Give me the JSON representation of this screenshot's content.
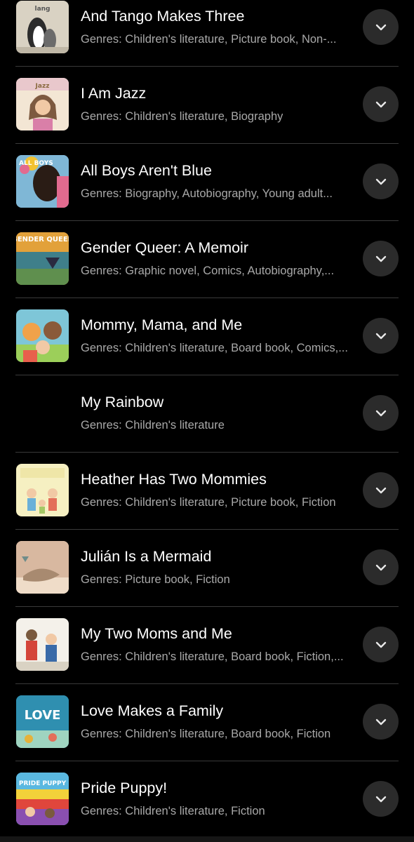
{
  "colors": {
    "background": "#000000",
    "title_text": "#ffffff",
    "genre_text": "#a9a9a9",
    "divider": "#3a3a3a",
    "expand_button_bg": "#2b2b2b",
    "chevron": "#e8e8e8"
  },
  "books": [
    {
      "title": "And Tango Makes Three",
      "genres": "Genres: Children's literature, Picture book, Non-...",
      "thumb_label": "lang",
      "thumb_colors": [
        "#d9d2c3",
        "#2c2c2c",
        "#ffffff",
        "#6b6b6b"
      ],
      "expand_icon": "chevron-down-icon"
    },
    {
      "title": "I Am Jazz",
      "genres": "Genres: Children's literature, Biography",
      "thumb_label": "Jazz",
      "thumb_colors": [
        "#f3e6d4",
        "#c4a38a",
        "#d97fa8",
        "#7d5a40"
      ],
      "expand_icon": "chevron-down-icon"
    },
    {
      "title": "All Boys Aren't Blue",
      "genres": "Genres: Biography, Autobiography, Young adult...",
      "thumb_label": "ALL BOYS",
      "thumb_colors": [
        "#7fb7d6",
        "#2a1c15",
        "#e26a8f",
        "#f2c230"
      ],
      "expand_icon": "chevron-down-icon"
    },
    {
      "title": "Gender Queer: A Memoir",
      "genres": "Genres: Graphic novel, Comics, Autobiography,...",
      "thumb_label": "GENDER QUEER",
      "thumb_colors": [
        "#e2a13a",
        "#3f7f8a",
        "#5f8f4e",
        "#2a2a40"
      ],
      "expand_icon": "chevron-down-icon"
    },
    {
      "title": "Mommy, Mama, and Me",
      "genres": "Genres: Children's literature, Board book, Comics,...",
      "thumb_label": "",
      "thumb_colors": [
        "#7ec6d8",
        "#f0a24a",
        "#e85f4c",
        "#9ccf5a"
      ],
      "expand_icon": "chevron-down-icon"
    },
    {
      "title": "My Rainbow",
      "genres": "Genres: Children's literature",
      "thumb_label": "",
      "thumb_colors": [],
      "expand_icon": "chevron-down-icon"
    },
    {
      "title": "Heather Has Two Mommies",
      "genres": "Genres: Children's literature, Picture book, Fiction",
      "thumb_label": "",
      "thumb_colors": [
        "#f6f0c2",
        "#6ab0d8",
        "#e36f5a",
        "#a5c865"
      ],
      "expand_icon": "chevron-down-icon"
    },
    {
      "title": "Julián Is a Mermaid",
      "genres": "Genres: Picture book, Fiction",
      "thumb_label": "",
      "thumb_colors": [
        "#d8b8a0",
        "#a88a70",
        "#6e8c8a",
        "#efdcc8"
      ],
      "expand_icon": "chevron-down-icon"
    },
    {
      "title": "My Two Moms and Me",
      "genres": "Genres: Children's literature, Board book, Fiction,...",
      "thumb_label": "",
      "thumb_colors": [
        "#f4f1ea",
        "#d4453a",
        "#3a6aa8",
        "#7a5a3e"
      ],
      "expand_icon": "chevron-down-icon"
    },
    {
      "title": "Love Makes a Family",
      "genres": "Genres: Children's literature, Board book, Fiction",
      "thumb_label": "LOVE",
      "thumb_colors": [
        "#2f8fb0",
        "#9fd4c0",
        "#ffffff",
        "#e6b23a"
      ],
      "expand_icon": "chevron-down-icon"
    },
    {
      "title": "Pride Puppy!",
      "genres": "Genres: Children's literature, Fiction",
      "thumb_label": "PRIDE PUPPY",
      "thumb_colors": [
        "#5ab8e0",
        "#f2d13a",
        "#e0463c",
        "#8a4fb0"
      ],
      "expand_icon": "chevron-down-icon"
    }
  ]
}
